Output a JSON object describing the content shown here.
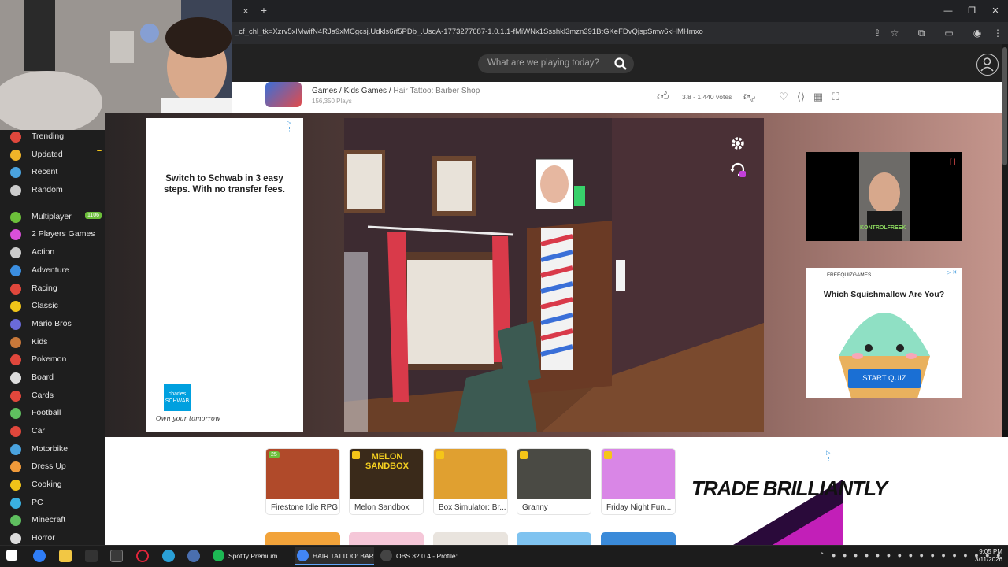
{
  "browser": {
    "url": "_cf_chl_tk=Xzrv5xlMwifN4RJa9xMCgcsj.Udkls6rf5PDb_.UsqA-1773277687-1.0.1.1-fMiWNx1Ssshkl3mzn391BtGKeFDvQjspSmw6kHMHmxo",
    "new_tab": "+",
    "close_tab": "×"
  },
  "site": {
    "search_placeholder": "What are we playing today?",
    "breadcrumb": {
      "games": "Games",
      "sep1": " / ",
      "kids": "Kids Games",
      "sep2": " / ",
      "current": "Hair Tattoo: Barber Shop"
    },
    "plays": "156,350 Plays",
    "rating": "3.8 - 1,440 votes"
  },
  "sidebar": {
    "items": [
      {
        "label": "Trending",
        "icon": "flame-icon",
        "color": "#e0473c"
      },
      {
        "label": "Updated",
        "icon": "check-icon",
        "color": "#f0b429",
        "badge": " "
      },
      {
        "label": "Recent",
        "icon": "clock-icon",
        "color": "#4aa3df"
      },
      {
        "label": "Random",
        "icon": "shuffle-icon",
        "color": "#cccccc"
      },
      {
        "label": "Multiplayer",
        "icon": "dots-icon",
        "color": "#6cbf3a",
        "badge": "1106"
      },
      {
        "label": "2 Players Games",
        "icon": "people-icon",
        "color": "#d94fd9"
      },
      {
        "label": "Action",
        "icon": "swords-icon",
        "color": "#cccccc"
      },
      {
        "label": "Adventure",
        "icon": "compass-icon",
        "color": "#3b8ee0"
      },
      {
        "label": "Racing",
        "icon": "flag-icon",
        "color": "#e0473c"
      },
      {
        "label": "Classic",
        "icon": "pacman-icon",
        "color": "#f0c419"
      },
      {
        "label": "Mario Bros",
        "icon": "mushroom-icon",
        "color": "#6a6ad9"
      },
      {
        "label": "Kids",
        "icon": "bear-icon",
        "color": "#c8783a"
      },
      {
        "label": "Pokemon",
        "icon": "pokeball-icon",
        "color": "#e0473c"
      },
      {
        "label": "Board",
        "icon": "pawn-icon",
        "color": "#dddddd"
      },
      {
        "label": "Cards",
        "icon": "cards-icon",
        "color": "#e0473c"
      },
      {
        "label": "Football",
        "icon": "ball-icon",
        "color": "#5fbf5f"
      },
      {
        "label": "Car",
        "icon": "car-icon",
        "color": "#e0473c"
      },
      {
        "label": "Motorbike",
        "icon": "bike-icon",
        "color": "#4aa3df"
      },
      {
        "label": "Dress Up",
        "icon": "shirt-icon",
        "color": "#f09a3a"
      },
      {
        "label": "Cooking",
        "icon": "cooking-icon",
        "color": "#f0c419"
      },
      {
        "label": "PC",
        "icon": "monitor-icon",
        "color": "#3ab0e0"
      },
      {
        "label": "Minecraft",
        "icon": "cube-icon",
        "color": "#5fbf5f"
      },
      {
        "label": "Horror",
        "icon": "ghost-icon",
        "color": "#dddddd"
      }
    ]
  },
  "ads": {
    "left_text": "Switch to Schwab in 3 easy steps. With no transfer fees.",
    "left_logo": "charles SCHWAB",
    "left_tagline": "Own your tomorrow",
    "quiz_brand": "FREEQUIZGAMES",
    "quiz_title": "Which Squishmallow Are You?",
    "quiz_cta": "START QUIZ",
    "trade_text": "TRADE BRILLIANTLY",
    "video_caption": "KONTROLFREEK"
  },
  "games": [
    {
      "label": "Firestone Idle RPG",
      "badge": "25",
      "color": "#b04a2a"
    },
    {
      "label": "Melon Sandbox",
      "title_art": "MELON SANDBOX",
      "color": "#3a2a1a"
    },
    {
      "label": "Box Simulator: Br...",
      "color": "#e0a030"
    },
    {
      "label": "Granny",
      "color": "#4a4a44"
    },
    {
      "label": "Friday Night Fun...",
      "color": "#d986e6"
    }
  ],
  "taskbar": {
    "apps": [
      {
        "label": "Spotify Premium",
        "color": "#1db954"
      },
      {
        "label": "HAIR TATTOO: BAR...",
        "color": "#4285f4"
      },
      {
        "label": "OBS 32.0.4 - Profile:...",
        "color": "#444444"
      }
    ],
    "time": "9:05 PM",
    "date": "3/11/2026"
  }
}
